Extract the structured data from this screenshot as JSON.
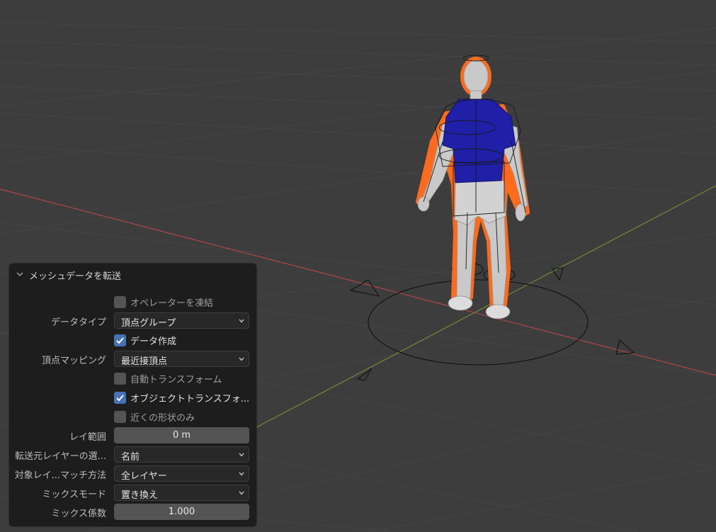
{
  "panel": {
    "title": "メッシュデータを転送",
    "freeze_operator": {
      "label": "オペレーターを凍結",
      "checked": false
    },
    "data_type": {
      "label": "データタイプ",
      "value": "頂点グループ"
    },
    "create_data": {
      "label": "データ作成",
      "checked": true
    },
    "vertex_mapping": {
      "label": "頂点マッピング",
      "value": "最近接頂点"
    },
    "auto_transform": {
      "label": "自動トランスフォーム",
      "checked": false
    },
    "object_transform": {
      "label": "オブジェクトトランスフォ...",
      "checked": true
    },
    "only_neighbor_geometry": {
      "label": "近くの形状のみ",
      "checked": false
    },
    "ray_radius": {
      "label": "レイ範囲",
      "value": "0 m"
    },
    "layers_select_src": {
      "label": "転送元レイヤーの選...",
      "value": "名前"
    },
    "layers_select_dst": {
      "label": "対象レイ...マッチ方法",
      "value": "全レイヤー"
    },
    "mix_mode": {
      "label": "ミックスモード",
      "value": "置き換え"
    },
    "mix_factor": {
      "label": "ミックス係数",
      "value": "1.000"
    }
  },
  "colors": {
    "background": "#3d3d3d",
    "panel": "#1d1d1d",
    "checkbox_on": "#4772b3",
    "x_axis": "#b14447",
    "y_axis": "#6f8b36",
    "selection_outline": "#ff6a1c",
    "shirt": "#1f1fa8"
  },
  "icons": {
    "panel_collapse": "chevron-down-icon",
    "dropdown": "chevron-down-icon",
    "check": "check-icon"
  }
}
